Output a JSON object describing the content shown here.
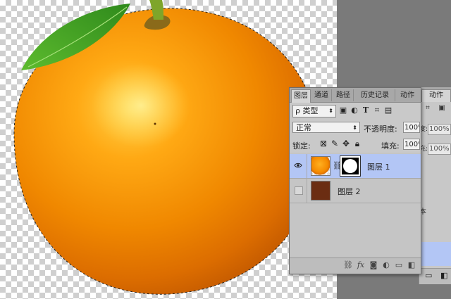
{
  "layers_panel": {
    "tabs": [
      "图层",
      "通道",
      "路径",
      "历史记录",
      "动作"
    ],
    "active_tab": "图层",
    "filter": {
      "kind_label": "ρ 类型",
      "icons": [
        "image-filter-icon",
        "adjustment-filter-icon",
        "type-filter-icon",
        "shape-filter-icon",
        "smart-object-filter-icon"
      ]
    },
    "blend_mode": "正常",
    "opacity_label": "不透明度:",
    "opacity_value": "100%",
    "lock_label": "锁定:",
    "lock_icons": [
      "lock-transparent-pixels-icon",
      "lock-image-pixels-icon",
      "lock-position-icon",
      "lock-all-icon"
    ],
    "fill_label": "填充:",
    "fill_value": "100%",
    "layers": [
      {
        "name": "图层 1",
        "visible": true,
        "selected": true,
        "thumbnail": "orange",
        "has_mask": true
      },
      {
        "name": "图层 2",
        "visible": false,
        "selected": false,
        "thumbnail": "brown-fill",
        "has_mask": false
      }
    ],
    "footer_icons": [
      "link-layers-icon",
      "fx-icon",
      "add-mask-icon",
      "adjustment-layer-icon",
      "new-group-icon",
      "new-layer-icon"
    ]
  },
  "back_panel": {
    "tab_label": "动作",
    "opacity_value": "100%",
    "fill_value": "100%",
    "partial_label_1": "度:",
    "partial_label_2": "充:",
    "partial_text": "本"
  },
  "colors": {
    "selected_row": "#b3c6f5",
    "panel_bg": "#c9c9c9",
    "workspace": "#7a7a7a",
    "orange": "#f08c00",
    "leaf": "#4aa22a"
  }
}
